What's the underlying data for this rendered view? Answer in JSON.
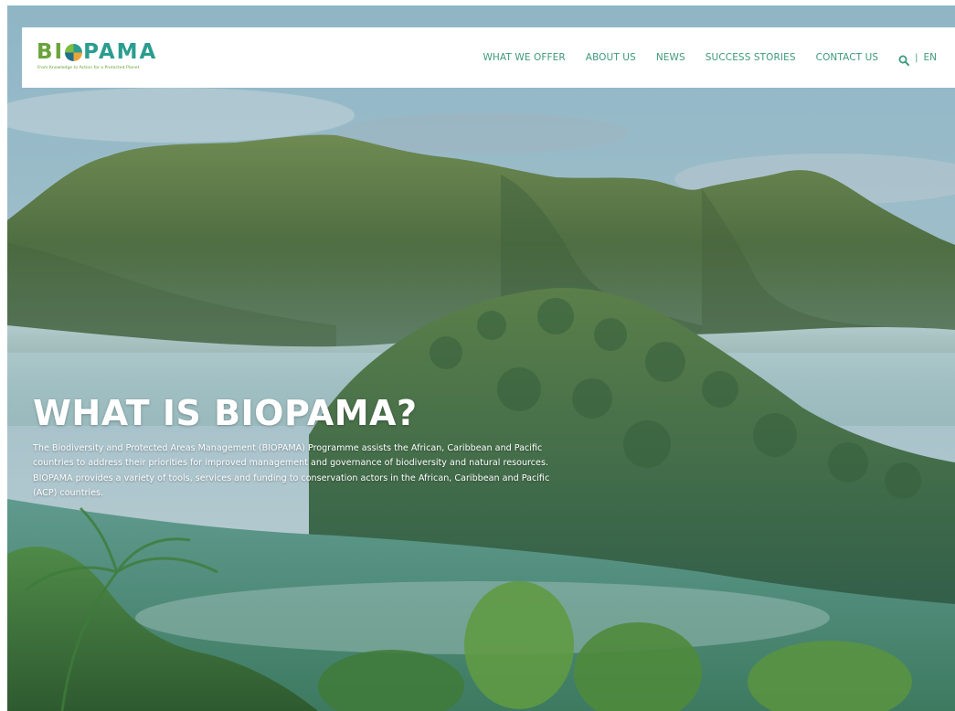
{
  "header": {
    "logo": {
      "wordmark_part1": "BI",
      "wordmark_part2": "PAMA",
      "tagline": "From Knowledge to Action for a Protected Planet"
    },
    "nav": {
      "items": [
        {
          "label": "WHAT WE OFFER"
        },
        {
          "label": "ABOUT US"
        },
        {
          "label": "NEWS"
        },
        {
          "label": "SUCCESS STORIES"
        },
        {
          "label": "CONTACT US"
        }
      ],
      "search_icon": "search-icon",
      "separator": "|",
      "language": "EN"
    }
  },
  "hero": {
    "title": "WHAT IS BIOPAMA?",
    "description": "The Biodiversity and Protected Areas Management (BIOPAMA) Programme assists the African, Caribbean and Pacific countries to address their priorities for improved management and governance of biodiversity and natural resources. BIOPAMA provides a variety of tools, services and funding to conservation actors in the African, Caribbean and Pacific (ACP) countries."
  },
  "colors": {
    "nav_text": "#3d9a7c",
    "logo_green": "#6aa33a",
    "logo_teal": "#2a9d8f",
    "hero_text": "#ffffff"
  }
}
